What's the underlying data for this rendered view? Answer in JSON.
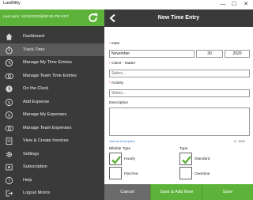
{
  "window": {
    "title": "LawBility",
    "minimize": "—",
    "maximize": "☐",
    "close": "✕"
  },
  "sidebar": {
    "sync_text": "Last sync: 11/30/2020@08:46 PM EST",
    "items": [
      {
        "label": "Dashboard",
        "icon": "home-icon"
      },
      {
        "label": "Track Time",
        "icon": "stopwatch-icon",
        "active": true
      },
      {
        "label": "Manage My Time Entries",
        "icon": "clock-icon"
      },
      {
        "label": "Manage Team Time Entries",
        "icon": "team-clock-icon"
      },
      {
        "label": "On the Clock",
        "icon": "timer-icon"
      },
      {
        "label": "Add Expense",
        "icon": "add-dollar-icon"
      },
      {
        "label": "Manage My Expenses",
        "icon": "dollar-icon"
      },
      {
        "label": "Manage Team Expenses",
        "icon": "team-dollar-icon"
      },
      {
        "label": "View & Create Invoices",
        "icon": "invoice-icon"
      },
      {
        "label": "Settings",
        "icon": "gear-icon"
      },
      {
        "label": "Subscription",
        "icon": "subscription-icon"
      },
      {
        "label": "Help",
        "icon": "help-icon"
      },
      {
        "label": "Logout Morris",
        "icon": "logout-icon"
      }
    ]
  },
  "main": {
    "title": "New Time Entry",
    "date": {
      "label": "Date",
      "month": "November",
      "day": "30",
      "year": "2020"
    },
    "client_matter": {
      "label": "Client - Matter",
      "placeholder": "Select..."
    },
    "activity": {
      "label": "Activity",
      "placeholder": "Select..."
    },
    "description": {
      "label": "Description",
      "internal_link": "Internal Description",
      "count": "0 / 1000"
    },
    "billable_type": {
      "label": "Billable Type",
      "options": [
        {
          "label": "Hourly",
          "checked": true
        },
        {
          "label": "Flat Fee",
          "checked": false
        }
      ]
    },
    "type": {
      "label": "Type",
      "options": [
        {
          "label": "Standard",
          "checked": true
        },
        {
          "label": "Overtime",
          "checked": false
        }
      ]
    }
  },
  "buttons": {
    "cancel": "Cancel",
    "save_add": "Save & Add New",
    "save": "Save"
  },
  "colors": {
    "green": "#5db339",
    "dark": "#3a3a3a",
    "active": "#5a5a5a",
    "link": "#3b78c6"
  }
}
